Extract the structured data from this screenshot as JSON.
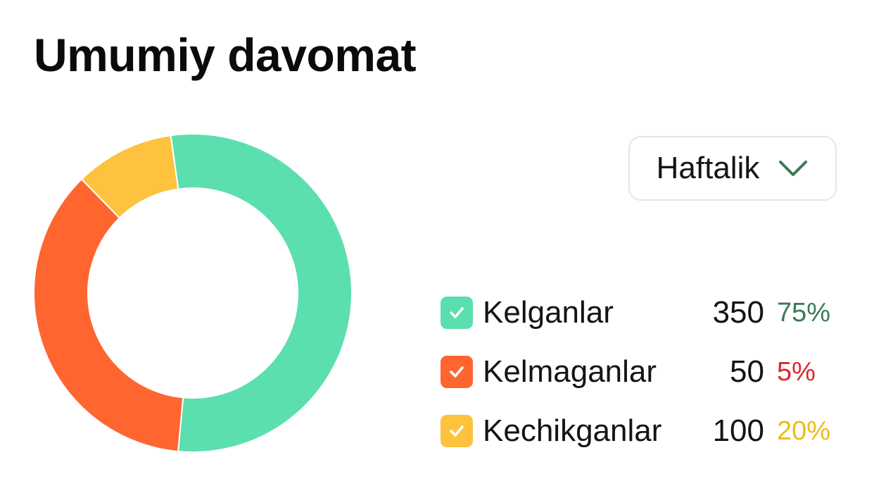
{
  "header": {
    "title": "Umumiy davomat"
  },
  "period_select": {
    "label": "Haftalik",
    "icon": "chevron-down-icon",
    "icon_color": "#3d7a55"
  },
  "legend": [
    {
      "label": "Kelganlar",
      "value": "350",
      "percent": "75%",
      "color": "#5bdfae",
      "percent_color": "#3d7a55",
      "icon": "check-icon"
    },
    {
      "label": "Kelmaganlar",
      "value": "50",
      "percent": "5%",
      "color": "#ff652f",
      "percent_color": "#e0262c",
      "icon": "check-icon"
    },
    {
      "label": "Kechikganlar",
      "value": "100",
      "percent": "20%",
      "color": "#fdc33e",
      "percent_color": "#eebc11",
      "icon": "check-icon"
    }
  ],
  "chart_data": {
    "type": "pie",
    "donut": true,
    "categories": [
      "Kelganlar",
      "Kelmaganlar",
      "Kechikganlar"
    ],
    "values": [
      350,
      50,
      100
    ],
    "displayed_share_percent": [
      53.7,
      36.2,
      10.1
    ],
    "colors": [
      "#5bdfae",
      "#ff652f",
      "#fdc33e"
    ],
    "start_angle_deg_clockwise_from_top": -8,
    "legend_placement": "right"
  }
}
